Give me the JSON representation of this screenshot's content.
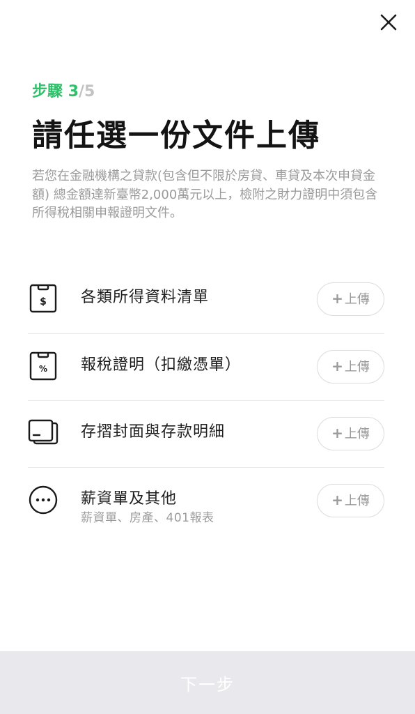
{
  "close": {
    "icon": "close-icon"
  },
  "step": {
    "label": "步驟",
    "current": "3",
    "separator": "/",
    "total": "5"
  },
  "title": "請任選一份文件上傳",
  "description": "若您在金融機構之貸款(包含但不限於房貸、車貸及本次申貸金額) 總金額達新臺幣2,000萬元以上，檢附之財力證明中須包含所得稅相關申報證明文件。",
  "documents": [
    {
      "name": "各類所得資料清單",
      "sub": "",
      "icon": "dollar-document-icon",
      "button": "上傳"
    },
    {
      "name": "報稅證明（扣繳憑單）",
      "sub": "",
      "icon": "percent-document-icon",
      "button": "上傳"
    },
    {
      "name": "存摺封面與存款明細",
      "sub": "",
      "icon": "passbook-icon",
      "button": "上傳"
    },
    {
      "name": "薪資單及其他",
      "sub": "薪資單、房產、401報表",
      "icon": "more-dots-icon",
      "button": "上傳"
    }
  ],
  "upload_plus": "+",
  "next_button": "下一步",
  "colors": {
    "accent": "#2fc06a",
    "muted": "#c2c2c2",
    "disabled_bar": "#e9e9ed"
  }
}
